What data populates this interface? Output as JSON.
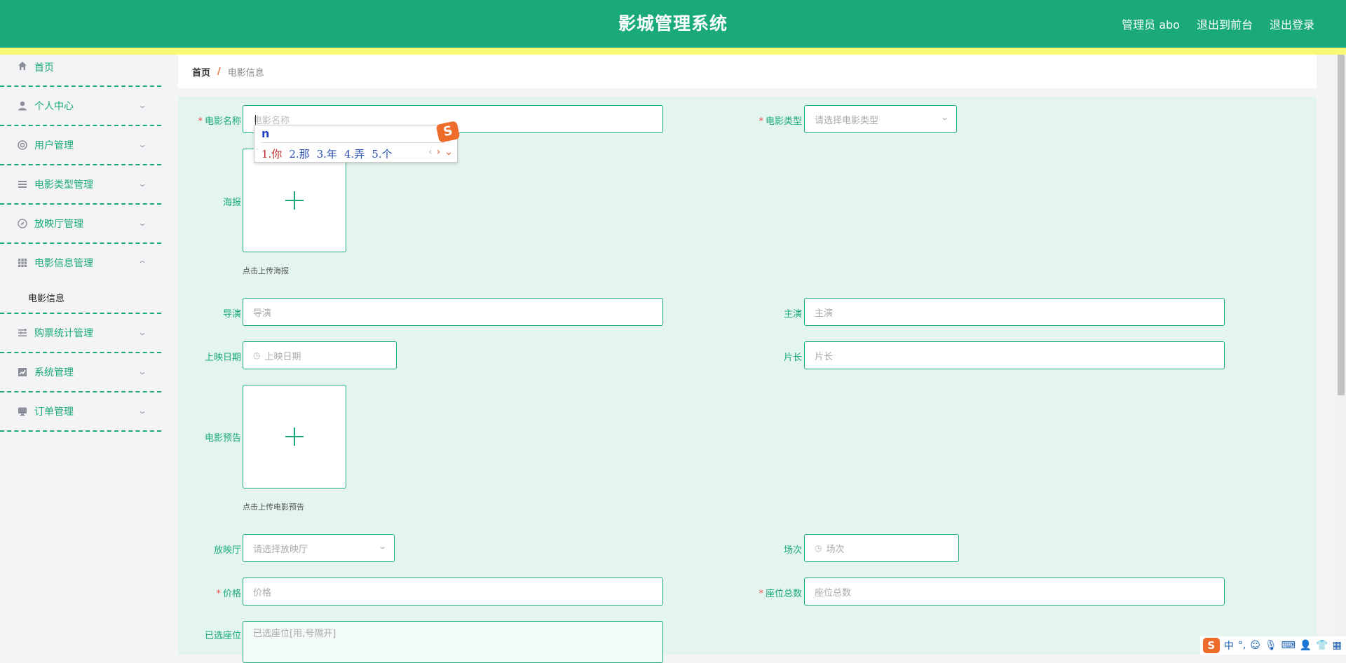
{
  "header": {
    "title": "影城管理系统",
    "admin_label": "管理员 abo",
    "front_label": "退出到前台",
    "logout_label": "退出登录"
  },
  "sidebar": {
    "items": [
      {
        "label": "首页",
        "icon": "home-icon"
      },
      {
        "label": "个人中心",
        "icon": "user-icon"
      },
      {
        "label": "用户管理",
        "icon": "lifebuoy-icon"
      },
      {
        "label": "电影类型管理",
        "icon": "list-icon"
      },
      {
        "label": "放映厅管理",
        "icon": "compass-icon"
      },
      {
        "label": "电影信息管理",
        "icon": "grid-icon"
      },
      {
        "label": "购票统计管理",
        "icon": "menu-icon"
      },
      {
        "label": "系统管理",
        "icon": "chart-icon"
      },
      {
        "label": "订单管理",
        "icon": "monitor-icon"
      }
    ],
    "sub_item": "电影信息"
  },
  "breadcrumb": {
    "home": "首页",
    "separator": "/",
    "current": "电影信息"
  },
  "form": {
    "movie_name": {
      "label": "电影名称",
      "placeholder": "电影名称"
    },
    "movie_type": {
      "label": "电影类型",
      "placeholder": "请选择电影类型"
    },
    "poster": {
      "label": "海报",
      "hint": "点击上传海报"
    },
    "director": {
      "label": "导演",
      "placeholder": "导演"
    },
    "actors": {
      "label": "主演",
      "placeholder": "主演"
    },
    "release_date": {
      "label": "上映日期",
      "placeholder": "上映日期"
    },
    "duration": {
      "label": "片长",
      "placeholder": "片长"
    },
    "trailer": {
      "label": "电影预告",
      "hint": "点击上传电影预告"
    },
    "hall": {
      "label": "放映厅",
      "placeholder": "请选择放映厅"
    },
    "session": {
      "label": "场次",
      "placeholder": "场次"
    },
    "price": {
      "label": "价格",
      "placeholder": "价格"
    },
    "seat_total": {
      "label": "座位总数",
      "placeholder": "座位总数"
    },
    "selected_seats": {
      "label": "已选座位",
      "placeholder": "已选座位[用,号隔开]"
    },
    "required_mark": "*"
  },
  "ime": {
    "composition": "n",
    "candidates": [
      "1.你",
      "2.那",
      "3.年",
      "4.弄",
      "5.个"
    ],
    "logo": "S"
  },
  "tray": {
    "lang": "中",
    "punct": "°,",
    "logo": "S"
  },
  "colors": {
    "primary": "#19a97b",
    "stripe": "#f9f871",
    "panel": "#e3f5ee",
    "required": "#f04d4d"
  }
}
